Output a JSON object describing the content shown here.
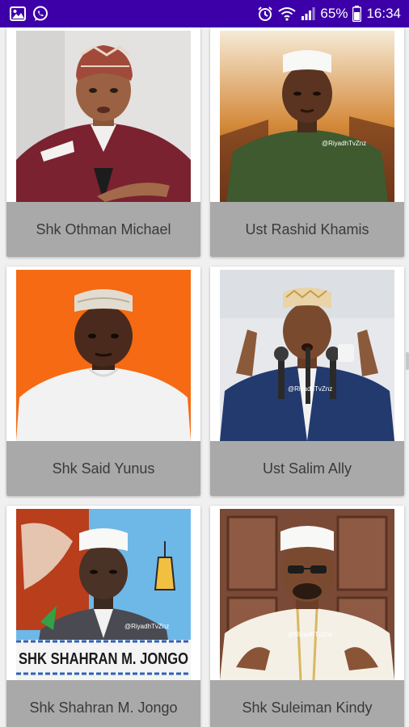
{
  "status_bar": {
    "battery_percent": "65%",
    "time": "16:34",
    "icons": [
      "gallery-icon",
      "whatsapp-icon",
      "alarm-icon",
      "wifi-icon",
      "signal-icon",
      "battery-icon"
    ]
  },
  "colors": {
    "status_bar": "#3d00a8",
    "card_label_bg": "#a9a9a9",
    "page_bg": "#f0f0f0"
  },
  "scholars": [
    {
      "name": "Shk Othman Michael"
    },
    {
      "name": "Ust Rashid Khamis",
      "watermark": "@RiyadhTvZnz"
    },
    {
      "name": "Shk Said Yunus"
    },
    {
      "name": "Ust Salim Ally",
      "watermark": "@RiyadhTvZnz"
    },
    {
      "name": "Shk Shahran M. Jongo",
      "banner_text": "SHK SHAHRAN M. JONGO",
      "watermark": "@RiyadhTvZnz"
    },
    {
      "name": "Shk Suleiman Kindy",
      "watermark": "@RiyadhTvZnz"
    }
  ]
}
